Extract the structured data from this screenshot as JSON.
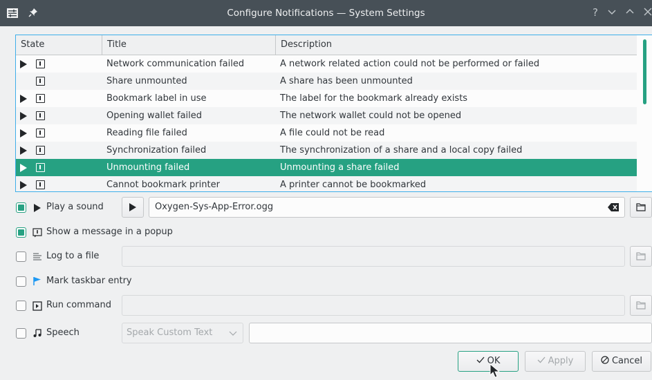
{
  "window": {
    "title": "Configure Notifications — System Settings",
    "controls": [
      "?",
      "⌄",
      "⌃",
      "✕"
    ]
  },
  "table": {
    "headers": {
      "state": "State",
      "title": "Title",
      "description": "Description"
    },
    "rows": [
      {
        "has_arrow": true,
        "title": "Network communication failed",
        "description": "A network related action could not be performed or failed",
        "selected": false
      },
      {
        "has_arrow": false,
        "title": "Share unmounted",
        "description": "A share has been unmounted",
        "selected": false
      },
      {
        "has_arrow": true,
        "title": "Bookmark label in use",
        "description": "The label for the bookmark already exists",
        "selected": false
      },
      {
        "has_arrow": true,
        "title": "Opening wallet failed",
        "description": "The network wallet could not be opened",
        "selected": false
      },
      {
        "has_arrow": true,
        "title": "Reading file failed",
        "description": "A file could not be read",
        "selected": false
      },
      {
        "has_arrow": true,
        "title": "Synchronization failed",
        "description": "The synchronization of a share and a local copy failed",
        "selected": false
      },
      {
        "has_arrow": true,
        "title": "Unmounting failed",
        "description": "Unmounting a share failed",
        "selected": true
      },
      {
        "has_arrow": true,
        "title": "Cannot bookmark printer",
        "description": "A printer cannot be bookmarked",
        "selected": false
      }
    ]
  },
  "options": {
    "play_sound": {
      "label": "Play a sound",
      "checked": true,
      "file": "Oxygen-Sys-App-Error.ogg"
    },
    "popup": {
      "label": "Show a message in a popup",
      "checked": true
    },
    "log_file": {
      "label": "Log to a file",
      "checked": false,
      "value": ""
    },
    "taskbar": {
      "label": "Mark taskbar entry",
      "checked": false
    },
    "run_command": {
      "label": "Run command",
      "checked": false,
      "value": ""
    },
    "speech": {
      "label": "Speech",
      "checked": false,
      "mode": "Speak Custom Text",
      "value": ""
    }
  },
  "buttons": {
    "ok": "OK",
    "apply": "Apply",
    "cancel": "Cancel"
  },
  "colors": {
    "accent": "#26a182",
    "focus": "#3daee9",
    "titlebar": "#475057"
  }
}
